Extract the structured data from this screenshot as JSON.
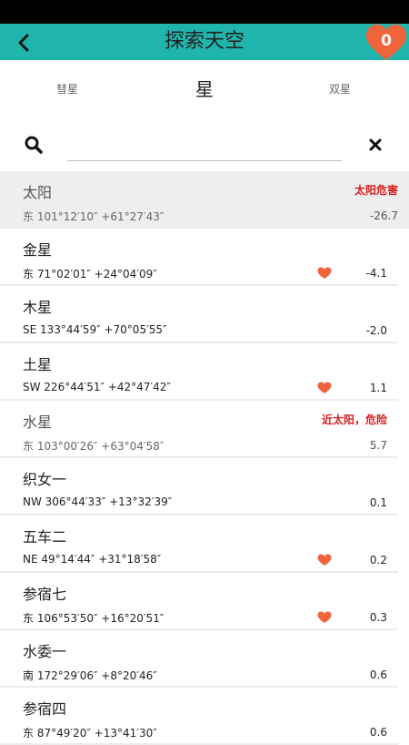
{
  "header": {
    "title": "探索天空",
    "back_label": "‹",
    "favorites_count": "0"
  },
  "colors": {
    "accent": "#1fb5ac",
    "heart": "#f0643c",
    "warning": "#d81e1e"
  },
  "tabs": [
    {
      "label": "彗星",
      "active": false
    },
    {
      "label": "星",
      "active": true
    },
    {
      "label": "双星",
      "active": false
    }
  ],
  "search": {
    "value": "",
    "placeholder": ""
  },
  "objects": [
    {
      "name": "太阳",
      "coord": "东 101°12′10″ +61°27′43″",
      "mag": "-26.7",
      "warning": "太阳危害",
      "fav": false
    },
    {
      "name": "金星",
      "coord": "东 71°02′01″ +24°04′09″",
      "mag": "-4.1",
      "warning": "",
      "fav": true
    },
    {
      "name": "木星",
      "coord": "SE 133°44′59″ +70°05′55″",
      "mag": "-2.0",
      "warning": "",
      "fav": false
    },
    {
      "name": "土星",
      "coord": "SW 226°44′51″ +42°47′42″",
      "mag": "1.1",
      "warning": "",
      "fav": true
    },
    {
      "name": "水星",
      "coord": "东 103°00′26″ +63°04′58″",
      "mag": "5.7",
      "warning": "近太阳，危险",
      "fav": false
    },
    {
      "name": "织女一",
      "coord": "NW 306°44′33″ +13°32′39″",
      "mag": "0.1",
      "warning": "",
      "fav": false
    },
    {
      "name": "五车二",
      "coord": "NE 49°14′44″ +31°18′58″",
      "mag": "0.2",
      "warning": "",
      "fav": true
    },
    {
      "name": "参宿七",
      "coord": "东 106°53′50″ +16°20′51″",
      "mag": "0.3",
      "warning": "",
      "fav": true
    },
    {
      "name": "水委一",
      "coord": "南 172°29′06″ +8°20′46″",
      "mag": "0.6",
      "warning": "",
      "fav": false
    },
    {
      "name": "参宿四",
      "coord": "东 87°49′20″ +13°41′30″",
      "mag": "0.6",
      "warning": "",
      "fav": false
    }
  ]
}
